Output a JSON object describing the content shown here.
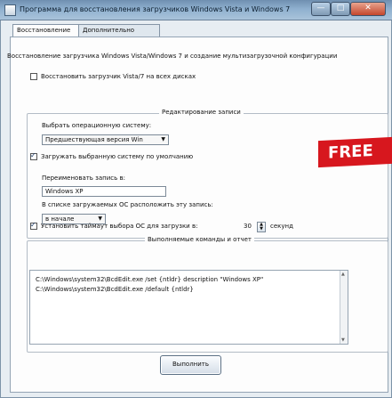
{
  "window": {
    "title": "Программа для восстановления загрузчиков Windows Vista и Windows 7",
    "controls": {
      "minimize": "—",
      "maximize": "□",
      "close": "✕"
    }
  },
  "tabs": [
    "Восстановление",
    "Дополнительно"
  ],
  "main": {
    "header": "Восстановление загрузчика Windows Vista/Windows 7 и создание мультизагрузочной конфигурации",
    "restore_checkbox_label": "Восстановить загрузчик Vista/7 на всех дисках",
    "restore_checked": false
  },
  "edit_group": {
    "title": "Редактирование записи",
    "choose_os_label": "Выбрать операционную систему:",
    "os_select_value": "Предшествующая версия Win",
    "load_default_label": "Загружать выбранную систему по умолчанию",
    "load_default_checked": true,
    "rename_label": "Переименовать запись в:",
    "rename_value": "Windows XP",
    "position_label": "В списке загружаемых ОС расположить эту запись:",
    "position_value": "в начале"
  },
  "timeout": {
    "label": "Установить таймаут выбора ОС для загрузки в:",
    "checked": true,
    "value": "30",
    "unit": "секунд"
  },
  "commands": {
    "title": "Выполняемые команды и отчет",
    "lines": [
      "C:\\Windows\\system32\\BcdEdit.exe /set {ntldr} description \"Windows XP\"",
      "C:\\Windows\\system32\\BcdEdit.exe /default {ntldr}"
    ]
  },
  "badge": {
    "text": "FREE"
  },
  "actions": {
    "run_label": "Выполнить"
  }
}
